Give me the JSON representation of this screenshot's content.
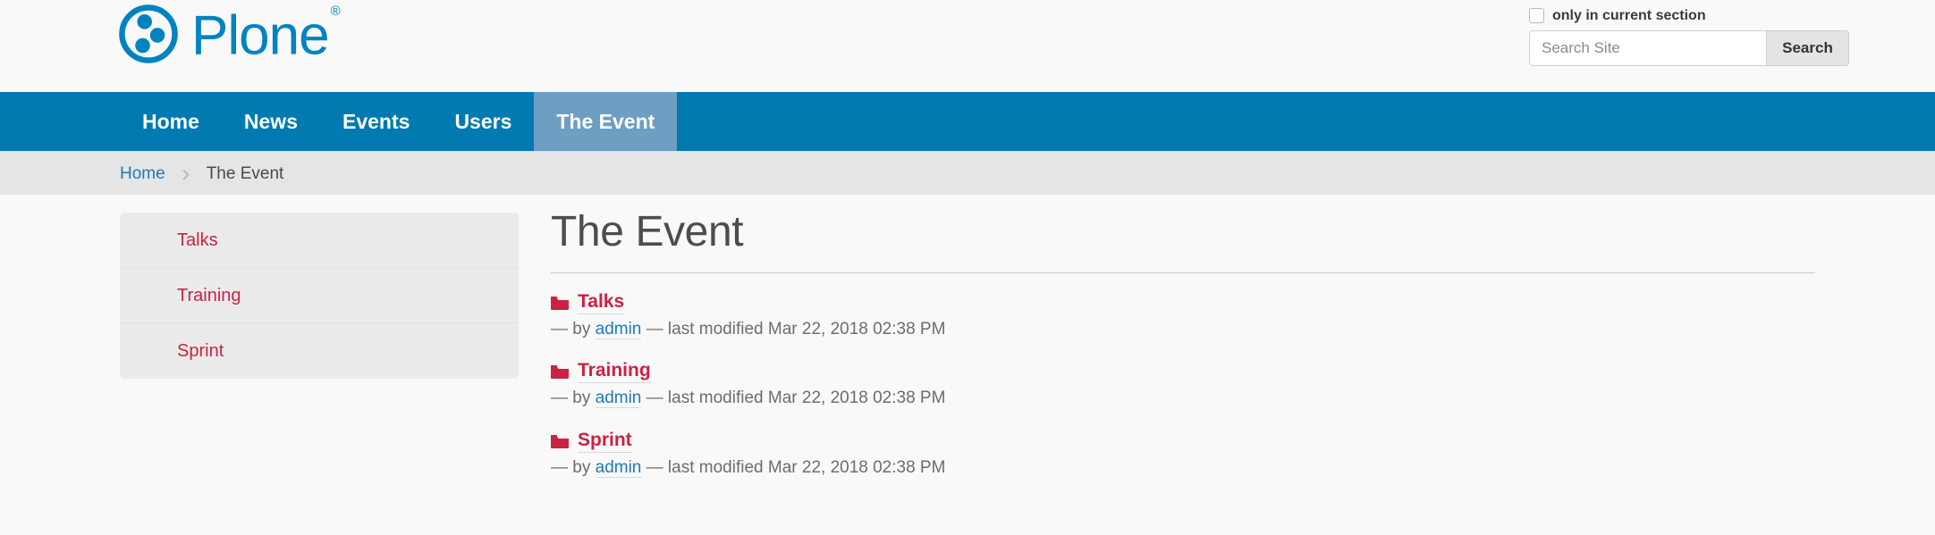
{
  "site": {
    "brand_name": "Plone",
    "brand_registered_mark": "®",
    "brand_color": "#0083be",
    "nav_bg_color": "#007ab0",
    "nav_active_bg_color": "#6e9ec2",
    "link_color": "#cb2244",
    "logo_icon": "plone-logo-icon"
  },
  "search": {
    "scope_checkbox_label": "only in current section",
    "scope_checked": false,
    "placeholder": "Search Site",
    "value": "",
    "button_label": "Search"
  },
  "nav": {
    "items": [
      {
        "label": "Home",
        "active": false
      },
      {
        "label": "News",
        "active": false
      },
      {
        "label": "Events",
        "active": false
      },
      {
        "label": "Users",
        "active": false
      },
      {
        "label": "The Event",
        "active": true
      }
    ]
  },
  "breadcrumb": {
    "home_label": "Home",
    "separator": "›",
    "current_label": "The Event"
  },
  "sidebar": {
    "items": [
      {
        "label": "Talks"
      },
      {
        "label": "Training"
      },
      {
        "label": "Sprint"
      }
    ]
  },
  "main": {
    "title": "The Event",
    "listing": [
      {
        "icon": "folder-icon",
        "title": "Talks",
        "meta_prefix": "— by ",
        "author": "admin",
        "meta_suffix": " — last modified Mar 22, 2018 02:38 PM"
      },
      {
        "icon": "folder-icon",
        "title": "Training",
        "meta_prefix": "— by ",
        "author": "admin",
        "meta_suffix": " — last modified Mar 22, 2018 02:38 PM"
      },
      {
        "icon": "folder-icon",
        "title": "Sprint",
        "meta_prefix": "— by ",
        "author": "admin",
        "meta_suffix": " — last modified Mar 22, 2018 02:38 PM"
      }
    ]
  }
}
